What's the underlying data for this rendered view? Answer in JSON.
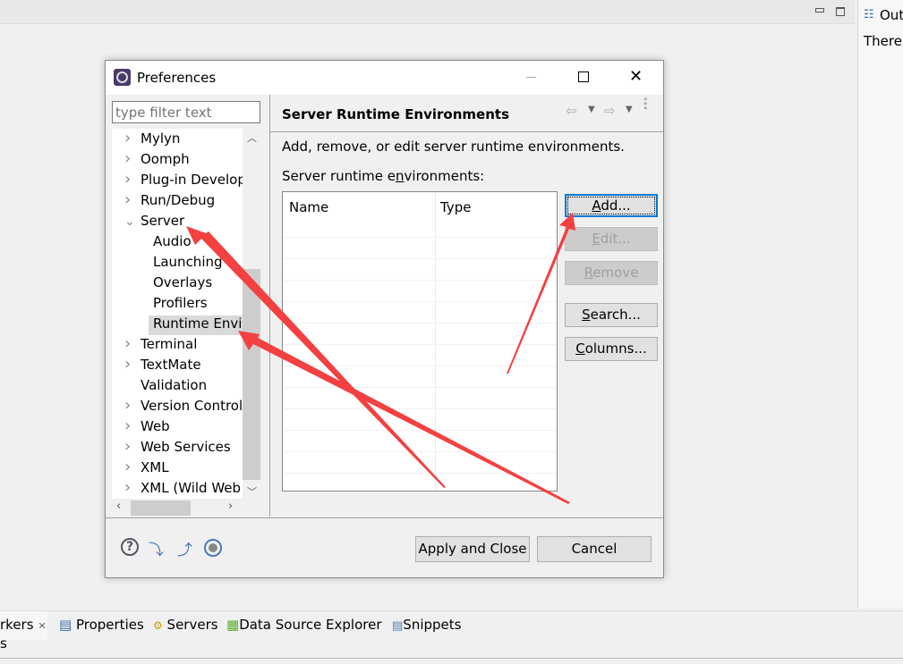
{
  "workspace": {
    "outline_tab": "Out",
    "outline_text": "There"
  },
  "bottom_tabs": [
    {
      "label": "rkers",
      "icon": "markers-icon"
    },
    {
      "label": "Properties",
      "icon": "properties-icon"
    },
    {
      "label": "Servers",
      "icon": "servers-icon"
    },
    {
      "label": "Data Source Explorer",
      "icon": "data-source-icon"
    },
    {
      "label": "Snippets",
      "icon": "snippets-icon"
    }
  ],
  "bottom_sub": "s",
  "dialog": {
    "title": "Preferences",
    "filter_placeholder": "type filter text",
    "tree": [
      {
        "label": "Mylyn",
        "expandable": true
      },
      {
        "label": "Oomph",
        "expandable": true
      },
      {
        "label": "Plug-in Developr",
        "expandable": true
      },
      {
        "label": "Run/Debug",
        "expandable": true
      },
      {
        "label": "Server",
        "expanded": true
      },
      {
        "label": "Audio",
        "child": true
      },
      {
        "label": "Launching",
        "child": true
      },
      {
        "label": "Overlays",
        "child": true
      },
      {
        "label": "Profilers",
        "child": true
      },
      {
        "label": "Runtime Envir",
        "child": true,
        "selected": true
      },
      {
        "label": "Terminal",
        "expandable": true
      },
      {
        "label": "TextMate",
        "expandable": true
      },
      {
        "label": "Validation"
      },
      {
        "label": "Version Control (",
        "expandable": true
      },
      {
        "label": "Web",
        "expandable": true
      },
      {
        "label": "Web Services",
        "expandable": true
      },
      {
        "label": "XML",
        "expandable": true
      },
      {
        "label": "XML (Wild Web I",
        "expandable": true
      }
    ],
    "page_title": "Server Runtime Environments",
    "description": "Add, remove, or edit server runtime environments.",
    "table_label_pre": "Server runtime e",
    "table_label_u": "n",
    "table_label_post": "vironments:",
    "columns": [
      "Name",
      "Type"
    ],
    "buttons": {
      "add": [
        "A",
        "dd..."
      ],
      "edit": [
        "E",
        "dit..."
      ],
      "remove": [
        "R",
        "emove"
      ],
      "search": [
        "S",
        "earch..."
      ],
      "columns": [
        "C",
        "olumns..."
      ]
    },
    "apply_close": "Apply and Close",
    "cancel": "Cancel"
  },
  "colors": {
    "annotation_arrow": "#f44040",
    "focus": "#0078d7"
  }
}
